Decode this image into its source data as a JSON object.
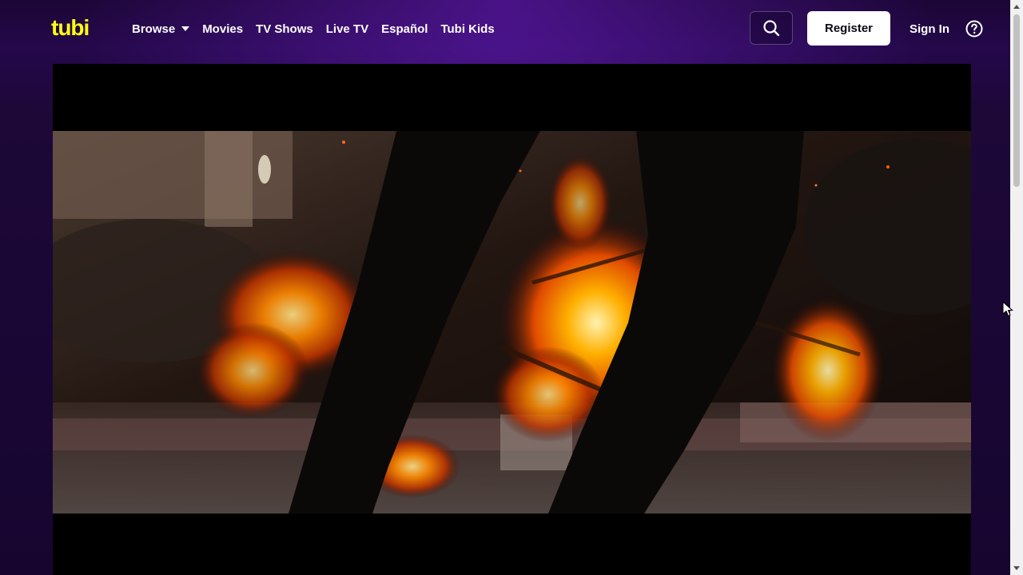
{
  "brand": {
    "logo_text": "tubi",
    "logo_color": "#FFFF13"
  },
  "nav": {
    "items": [
      {
        "label": "Browse",
        "has_dropdown": true
      },
      {
        "label": "Movies"
      },
      {
        "label": "TV Shows"
      },
      {
        "label": "Live TV"
      },
      {
        "label": "Español"
      },
      {
        "label": "Tubi Kids"
      }
    ]
  },
  "header": {
    "search_icon": "search-icon",
    "register_label": "Register",
    "signin_label": "Sign In",
    "help_icon": "help-circle-icon"
  },
  "player": {
    "content": "video-frame"
  },
  "colors": {
    "background": "#1c0636",
    "accent_purple": "#4a1590",
    "register_bg": "#FFFFFF"
  }
}
